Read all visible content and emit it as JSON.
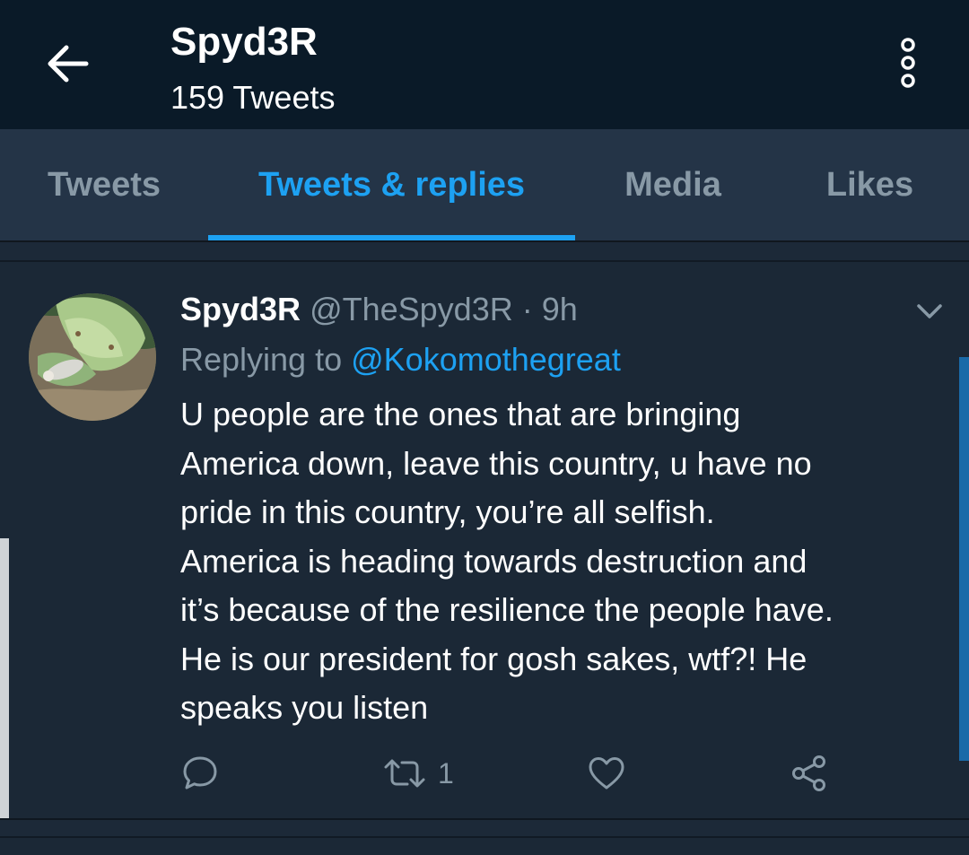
{
  "header": {
    "title": "Spyd3R",
    "subtitle": "159 Tweets",
    "back_icon": "arrow-left-icon",
    "more_icon": "vertical-dots-icon"
  },
  "tabs": [
    {
      "label": "Tweets",
      "active": false
    },
    {
      "label": "Tweets & replies",
      "active": true
    },
    {
      "label": "Media",
      "active": false
    },
    {
      "label": "Likes",
      "active": false
    }
  ],
  "tweet": {
    "name": "Spyd3R",
    "handle": "@TheSpyd3R",
    "separator": "·",
    "time": "9h",
    "replying_prefix": "Replying to",
    "replying_to": "@Kokomothegreat",
    "lines": [
      "U people are the ones that are bringing",
      "America down, leave this country, u have no",
      "pride in this country, you’re all selfish.",
      "America is heading towards destruction and",
      "it’s because of the resilience the people have.",
      "He is our president for gosh sakes, wtf?! He",
      "speaks you listen"
    ],
    "actions": {
      "reply_icon": "comment-icon",
      "retweet_icon": "retweet-icon",
      "retweet_count": "1",
      "like_icon": "heart-icon",
      "share_icon": "share-icon"
    }
  },
  "colors": {
    "accent": "#1da1f2",
    "header_bg": "#0a1a28",
    "tab_bg": "#243447",
    "body_bg": "#1b2836",
    "muted_text": "#8899a6"
  }
}
